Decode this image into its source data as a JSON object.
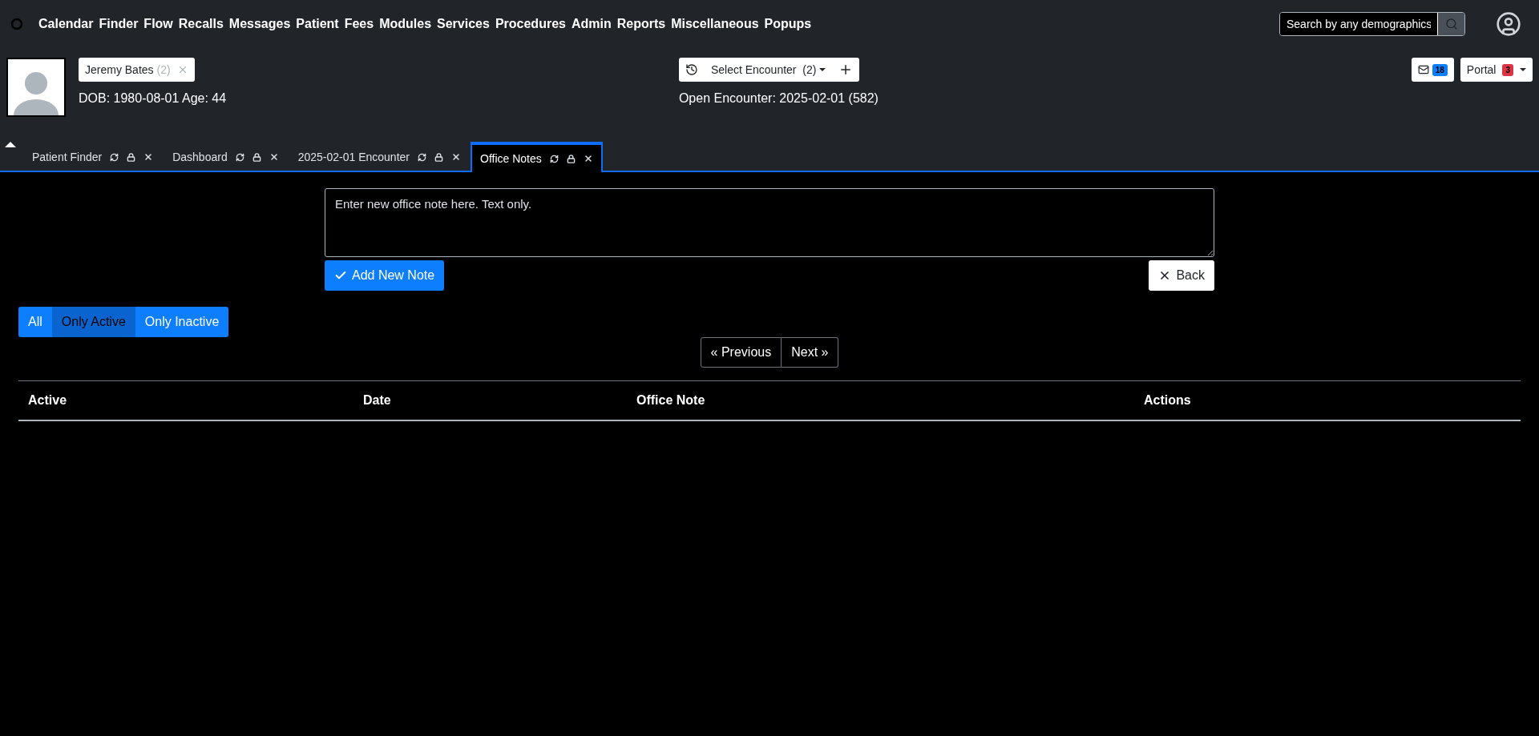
{
  "nav": {
    "items": [
      "Calendar",
      "Finder",
      "Flow",
      "Recalls",
      "Messages",
      "Patient",
      "Fees",
      "Modules",
      "Services",
      "Procedures",
      "Admin",
      "Reports",
      "Miscellaneous",
      "Popups"
    ],
    "search": {
      "placeholder": "Search by any demographics"
    }
  },
  "patient": {
    "name": "Jeremy Bates",
    "count": "(2)",
    "dob": "DOB: 1980-08-01 Age: 44"
  },
  "encounter": {
    "label": "Select Encounter",
    "count": "(2)",
    "open": "Open Encounter: 2025-02-01 (582)"
  },
  "messages": {
    "count": "18"
  },
  "portal": {
    "label": "Portal",
    "count": "3"
  },
  "tabs": [
    {
      "label": "Patient Finder",
      "selected": false
    },
    {
      "label": "Dashboard",
      "selected": false
    },
    {
      "label": "2025-02-01 Encounter",
      "selected": false
    },
    {
      "label": "Office Notes",
      "selected": true
    }
  ],
  "note": {
    "placeholder": "Enter new office note here. Text only."
  },
  "add_button": "Add New Note",
  "back_button": "Back",
  "filters": [
    {
      "label": "All",
      "selected": false
    },
    {
      "label": "Only Active",
      "selected": true
    },
    {
      "label": "Only Inactive",
      "selected": false
    }
  ],
  "pagination": {
    "previous": "« Previous",
    "next": "Next »"
  },
  "table": {
    "columns": [
      "Active",
      "Date",
      "Office Note",
      "Actions"
    ]
  }
}
